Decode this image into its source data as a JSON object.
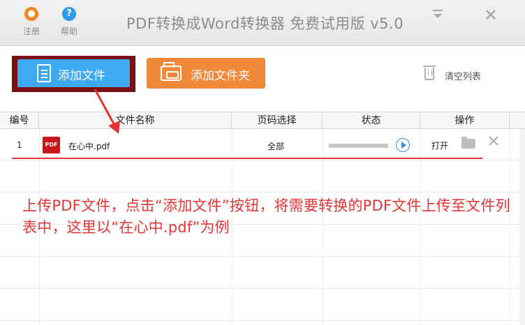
{
  "titlebar": {
    "register_label": "注册",
    "help_label": "帮助",
    "title": "PDF转换成Word转换器 免费试用版 v5.0"
  },
  "toolbar": {
    "add_file_label": "添加文件",
    "add_folder_label": "添加文件夹",
    "clear_list_label": "清空列表"
  },
  "table": {
    "headers": [
      "编号",
      "文件名称",
      "页码选择",
      "状态",
      "操作"
    ],
    "rows": [
      {
        "index": "1",
        "file_name": "在心中.pdf",
        "file_icon_text": "PDF",
        "pages": "全部",
        "progress": 0,
        "open_label": "打开"
      }
    ]
  },
  "annotation": {
    "text": "上传PDF文件，点击“添加文件”按钮，将需要转换的PDF文件上传至文件列表中，这里以“在心中.pdf”为例"
  },
  "colors": {
    "accent_blue": "#3eaaf3",
    "accent_orange": "#f08a3a",
    "highlight_red": "#7a0f14",
    "annotation_red": "#e53434"
  },
  "icons": {
    "register": "user-icon",
    "help": "question-icon",
    "minimize": "minimize-icon",
    "close": "close-icon",
    "add_file": "document-icon",
    "add_folder": "folder-icon",
    "clear": "trash-icon",
    "file": "pdf-icon",
    "start": "play-icon",
    "browse": "folder-open-icon",
    "delete": "close-icon"
  }
}
